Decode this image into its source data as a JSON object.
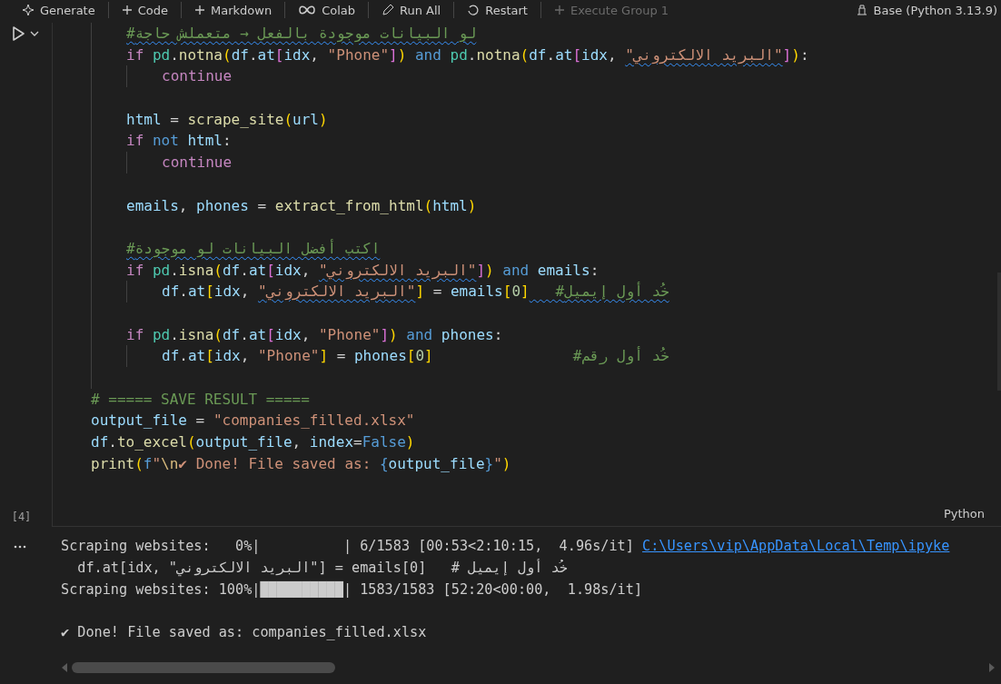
{
  "toolbar": {
    "items": [
      {
        "kind": "sparkle",
        "label": "Generate",
        "disabled": false
      },
      {
        "kind": "plus",
        "label": "Code",
        "disabled": false
      },
      {
        "kind": "plus",
        "label": "Markdown",
        "disabled": false
      },
      {
        "kind": "colab",
        "label": "Colab",
        "disabled": false
      },
      {
        "kind": "runall",
        "label": "Run All",
        "disabled": false
      },
      {
        "kind": "restart",
        "label": "Restart",
        "disabled": false
      },
      {
        "kind": "plus",
        "label": "Execute Group 1",
        "disabled": true
      }
    ],
    "kernel": "Base (Python 3.13.9)"
  },
  "cell": {
    "execution_count": "[4]",
    "language": "Python",
    "lines": [
      {
        "kind": "block",
        "children": [
          {
            "kind": "code",
            "tokens": [
              {
                "kind": "cmtw",
                "text": "#لو البيانات موجودة بالفعل → متعملش حاجة"
              }
            ]
          },
          {
            "kind": "code",
            "tokens": [
              {
                "kind": "kw",
                "text": "if "
              },
              {
                "kind": "mod",
                "text": "pd"
              },
              {
                "kind": "p",
                "text": "."
              },
              {
                "kind": "fn",
                "text": "notna"
              },
              {
                "kind": "b1",
                "text": "("
              },
              {
                "kind": "var",
                "text": "df"
              },
              {
                "kind": "p",
                "text": "."
              },
              {
                "kind": "var",
                "text": "at"
              },
              {
                "kind": "b2",
                "text": "["
              },
              {
                "kind": "var",
                "text": "idx"
              },
              {
                "kind": "p",
                "text": ", "
              },
              {
                "kind": "str",
                "text": "\"Phone\""
              },
              {
                "kind": "b2",
                "text": "]"
              },
              {
                "kind": "b1",
                "text": ")"
              },
              {
                "kind": "op",
                "text": " and "
              },
              {
                "kind": "mod",
                "text": "pd"
              },
              {
                "kind": "p",
                "text": "."
              },
              {
                "kind": "fn",
                "text": "notna"
              },
              {
                "kind": "b1",
                "text": "("
              },
              {
                "kind": "var",
                "text": "df"
              },
              {
                "kind": "p",
                "text": "."
              },
              {
                "kind": "var",
                "text": "at"
              },
              {
                "kind": "b2",
                "text": "["
              },
              {
                "kind": "var",
                "text": "idx"
              },
              {
                "kind": "p",
                "text": ", "
              },
              {
                "kind": "strw",
                "text": "\"البريد الالكتروني\""
              },
              {
                "kind": "b2",
                "text": "]"
              },
              {
                "kind": "b1",
                "text": ")"
              },
              {
                "kind": "p",
                "text": ":"
              }
            ],
            "children": [
              {
                "kind": "code",
                "tokens": [
                  {
                    "kind": "kw",
                    "text": "continue"
                  }
                ]
              }
            ]
          },
          {
            "kind": "blank"
          },
          {
            "kind": "code",
            "tokens": [
              {
                "kind": "var",
                "text": "html"
              },
              {
                "kind": "p",
                "text": " = "
              },
              {
                "kind": "fn",
                "text": "scrape_site"
              },
              {
                "kind": "b1",
                "text": "("
              },
              {
                "kind": "var",
                "text": "url"
              },
              {
                "kind": "b1",
                "text": ")"
              }
            ]
          },
          {
            "kind": "code",
            "tokens": [
              {
                "kind": "kw",
                "text": "if "
              },
              {
                "kind": "op",
                "text": "not "
              },
              {
                "kind": "var",
                "text": "html"
              },
              {
                "kind": "p",
                "text": ":"
              }
            ],
            "children": [
              {
                "kind": "code",
                "tokens": [
                  {
                    "kind": "kw",
                    "text": "continue"
                  }
                ]
              }
            ]
          },
          {
            "kind": "blank"
          },
          {
            "kind": "code",
            "tokens": [
              {
                "kind": "var",
                "text": "emails"
              },
              {
                "kind": "p",
                "text": ", "
              },
              {
                "kind": "var",
                "text": "phones"
              },
              {
                "kind": "p",
                "text": " = "
              },
              {
                "kind": "fn",
                "text": "extract_from_html"
              },
              {
                "kind": "b1",
                "text": "("
              },
              {
                "kind": "var",
                "text": "html"
              },
              {
                "kind": "b1",
                "text": ")"
              }
            ]
          },
          {
            "kind": "blank"
          },
          {
            "kind": "code",
            "tokens": [
              {
                "kind": "cmtw",
                "text": "#اكتب أفضل البيانات لو موجودة"
              }
            ]
          },
          {
            "kind": "code",
            "tokens": [
              {
                "kind": "kw",
                "text": "if "
              },
              {
                "kind": "mod",
                "text": "pd"
              },
              {
                "kind": "p",
                "text": "."
              },
              {
                "kind": "fn",
                "text": "isna"
              },
              {
                "kind": "b1",
                "text": "("
              },
              {
                "kind": "var",
                "text": "df"
              },
              {
                "kind": "p",
                "text": "."
              },
              {
                "kind": "var",
                "text": "at"
              },
              {
                "kind": "b2",
                "text": "["
              },
              {
                "kind": "var",
                "text": "idx"
              },
              {
                "kind": "p",
                "text": ", "
              },
              {
                "kind": "strw",
                "text": "\"البريد الالكتروني\""
              },
              {
                "kind": "b2",
                "text": "]"
              },
              {
                "kind": "b1",
                "text": ")"
              },
              {
                "kind": "op",
                "text": " and "
              },
              {
                "kind": "var",
                "text": "emails"
              },
              {
                "kind": "p",
                "text": ":"
              }
            ],
            "children": [
              {
                "kind": "code",
                "tokens": [
                  {
                    "kind": "var",
                    "text": "df"
                  },
                  {
                    "kind": "p",
                    "text": "."
                  },
                  {
                    "kind": "var",
                    "text": "at"
                  },
                  {
                    "kind": "b1",
                    "text": "["
                  },
                  {
                    "kind": "var",
                    "text": "idx"
                  },
                  {
                    "kind": "p",
                    "text": ", "
                  },
                  {
                    "kind": "strw",
                    "text": "\"البريد الالكتروني\""
                  },
                  {
                    "kind": "b1",
                    "text": "]"
                  },
                  {
                    "kind": "p",
                    "text": " = "
                  },
                  {
                    "kind": "var",
                    "text": "emails"
                  },
                  {
                    "kind": "b1",
                    "text": "["
                  },
                  {
                    "kind": "num",
                    "text": "0"
                  },
                  {
                    "kind": "b1",
                    "text": "]"
                  },
                  {
                    "kind": "cmtw",
                    "text": "   #خُد أول إيميل"
                  }
                ]
              }
            ]
          },
          {
            "kind": "blank"
          },
          {
            "kind": "code",
            "tokens": [
              {
                "kind": "kw",
                "text": "if "
              },
              {
                "kind": "mod",
                "text": "pd"
              },
              {
                "kind": "p",
                "text": "."
              },
              {
                "kind": "fn",
                "text": "isna"
              },
              {
                "kind": "b1",
                "text": "("
              },
              {
                "kind": "var",
                "text": "df"
              },
              {
                "kind": "p",
                "text": "."
              },
              {
                "kind": "var",
                "text": "at"
              },
              {
                "kind": "b2",
                "text": "["
              },
              {
                "kind": "var",
                "text": "idx"
              },
              {
                "kind": "p",
                "text": ", "
              },
              {
                "kind": "str",
                "text": "\"Phone\""
              },
              {
                "kind": "b2",
                "text": "]"
              },
              {
                "kind": "b1",
                "text": ")"
              },
              {
                "kind": "op",
                "text": " and "
              },
              {
                "kind": "var",
                "text": "phones"
              },
              {
                "kind": "p",
                "text": ":"
              }
            ],
            "children": [
              {
                "kind": "code",
                "tokens": [
                  {
                    "kind": "var",
                    "text": "df"
                  },
                  {
                    "kind": "p",
                    "text": "."
                  },
                  {
                    "kind": "var",
                    "text": "at"
                  },
                  {
                    "kind": "b1",
                    "text": "["
                  },
                  {
                    "kind": "var",
                    "text": "idx"
                  },
                  {
                    "kind": "p",
                    "text": ", "
                  },
                  {
                    "kind": "str",
                    "text": "\"Phone\""
                  },
                  {
                    "kind": "b1",
                    "text": "]"
                  },
                  {
                    "kind": "p",
                    "text": " = "
                  },
                  {
                    "kind": "var",
                    "text": "phones"
                  },
                  {
                    "kind": "b1",
                    "text": "["
                  },
                  {
                    "kind": "num",
                    "text": "0"
                  },
                  {
                    "kind": "b1",
                    "text": "]"
                  },
                  {
                    "kind": "cmt",
                    "text": "                #خُد أول رقم"
                  }
                ]
              }
            ]
          },
          {
            "kind": "blank"
          }
        ]
      },
      {
        "kind": "code",
        "tokens": [
          {
            "kind": "cmt",
            "text": "# ===== SAVE RESULT ====="
          }
        ]
      },
      {
        "kind": "code",
        "tokens": [
          {
            "kind": "var",
            "text": "output_file"
          },
          {
            "kind": "p",
            "text": " = "
          },
          {
            "kind": "str",
            "text": "\"companies_filled.xlsx\""
          }
        ]
      },
      {
        "kind": "code",
        "tokens": [
          {
            "kind": "var",
            "text": "df"
          },
          {
            "kind": "p",
            "text": "."
          },
          {
            "kind": "fn",
            "text": "to_excel"
          },
          {
            "kind": "b1",
            "text": "("
          },
          {
            "kind": "var",
            "text": "output_file"
          },
          {
            "kind": "p",
            "text": ", "
          },
          {
            "kind": "var",
            "text": "index"
          },
          {
            "kind": "p",
            "text": "="
          },
          {
            "kind": "op",
            "text": "False"
          },
          {
            "kind": "b1",
            "text": ")"
          }
        ]
      },
      {
        "kind": "code",
        "tokens": [
          {
            "kind": "fn",
            "text": "print"
          },
          {
            "kind": "b1",
            "text": "("
          },
          {
            "kind": "op",
            "text": "f"
          },
          {
            "kind": "str",
            "text": "\""
          },
          {
            "kind": "esc",
            "text": "\\n"
          },
          {
            "kind": "str",
            "text": "✔ Done! File saved as: "
          },
          {
            "kind": "op",
            "text": "{"
          },
          {
            "kind": "var",
            "text": "output_file"
          },
          {
            "kind": "op",
            "text": "}"
          },
          {
            "kind": "str",
            "text": "\""
          },
          {
            "kind": "b1",
            "text": ")"
          }
        ]
      }
    ]
  },
  "output": {
    "lines": [
      {
        "kind": "text",
        "parts": [
          {
            "kind": "text",
            "text": "Scraping websites:   0%|          | 6/1583 [00:53<2:10:15,  4.96s/it] "
          },
          {
            "kind": "link",
            "text": "C:\\Users\\vip\\AppData\\Local\\Temp\\ipyke"
          }
        ]
      },
      {
        "kind": "text",
        "parts": [
          {
            "kind": "text",
            "text": "  df.at[idx, \"البريد الالكتروني\"] = emails[0]   # خُد أول إيميل"
          }
        ]
      },
      {
        "kind": "text",
        "parts": [
          {
            "kind": "text",
            "text": "Scraping websites: 100%|██████████| 1583/1583 [52:20<00:00,  1.98s/it]"
          }
        ]
      },
      {
        "kind": "blank"
      },
      {
        "kind": "text",
        "parts": [
          {
            "kind": "text",
            "text": "✔ Done! File saved as: companies_filled.xlsx"
          }
        ]
      }
    ]
  }
}
